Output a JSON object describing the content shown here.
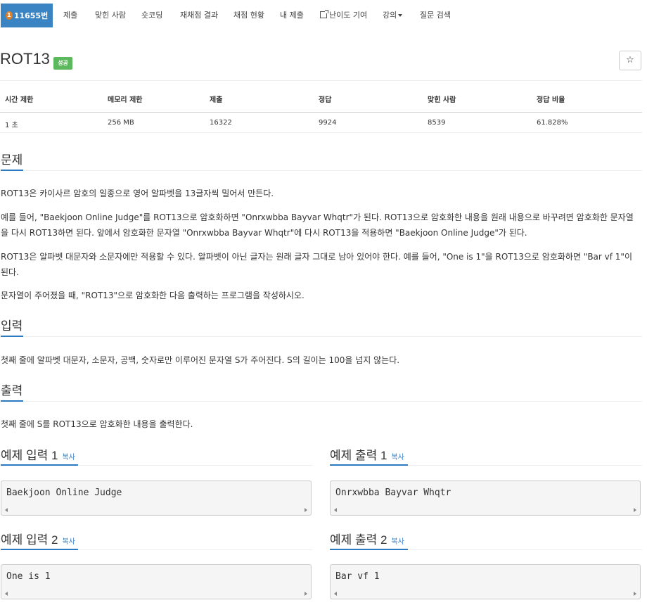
{
  "nav": {
    "problem_number": "11655번",
    "items": [
      "제출",
      "맞힌 사람",
      "숏코딩",
      "재채점 결과",
      "채점 현황",
      "내 제출",
      "난이도 기여",
      "강의",
      "질문 검색"
    ]
  },
  "problem": {
    "title": "ROT13",
    "status_badge": "성공",
    "star": "☆"
  },
  "info": {
    "headers": [
      "시간 제한",
      "메모리 제한",
      "제출",
      "정답",
      "맞힌 사람",
      "정답 비율"
    ],
    "values": [
      "1 초",
      "256 MB",
      "16322",
      "9924",
      "8539",
      "61.828%"
    ]
  },
  "sections": {
    "problem_title": "문제",
    "problem_paragraphs": [
      "ROT13은 카이사르 암호의 일종으로 영어 알파벳을 13글자씩 밀어서 만든다.",
      "예를 들어, \"Baekjoon Online Judge\"를 ROT13으로 암호화하면 \"Onrxwbba Bayvar Whqtr\"가 된다. ROT13으로 암호화한 내용을 원래 내용으로 바꾸려면 암호화한 문자열을 다시 ROT13하면 된다. 앞에서 암호화한 문자열 \"Onrxwbba Bayvar Whqtr\"에 다시 ROT13을 적용하면 \"Baekjoon Online Judge\"가 된다.",
      "ROT13은 알파벳 대문자와 소문자에만 적용할 수 있다. 알파벳이 아닌 글자는 원래 글자 그대로 남아 있어야 한다. 예를 들어, \"One is 1\"을 ROT13으로 암호화하면 \"Bar vf 1\"이 된다.",
      "문자열이 주어졌을 때, \"ROT13\"으로 암호화한 다음 출력하는 프로그램을 작성하시오."
    ],
    "input_title": "입력",
    "input_text": "첫째 줄에 알파벳 대문자, 소문자, 공백, 숫자로만 이루어진 문자열 S가 주어진다. S의 길이는 100을 넘지 않는다.",
    "output_title": "출력",
    "output_text": "첫째 줄에 S를 ROT13으로 암호화한 내용을 출력한다."
  },
  "samples": [
    {
      "title": "예제 입력 1",
      "copy": "복사",
      "content": "Baekjoon Online Judge"
    },
    {
      "title": "예제 출력 1",
      "copy": "복사",
      "content": "Onrxwbba Bayvar Whqtr"
    },
    {
      "title": "예제 입력 2",
      "copy": "복사",
      "content": "One is 1"
    },
    {
      "title": "예제 출력 2",
      "copy": "복사",
      "content": "Bar vf 1"
    }
  ],
  "colors": {
    "nav_active": "#3a84c4",
    "badge": "#5cb85c",
    "link": "#3a7fc1",
    "underline": "#2b79c2"
  }
}
